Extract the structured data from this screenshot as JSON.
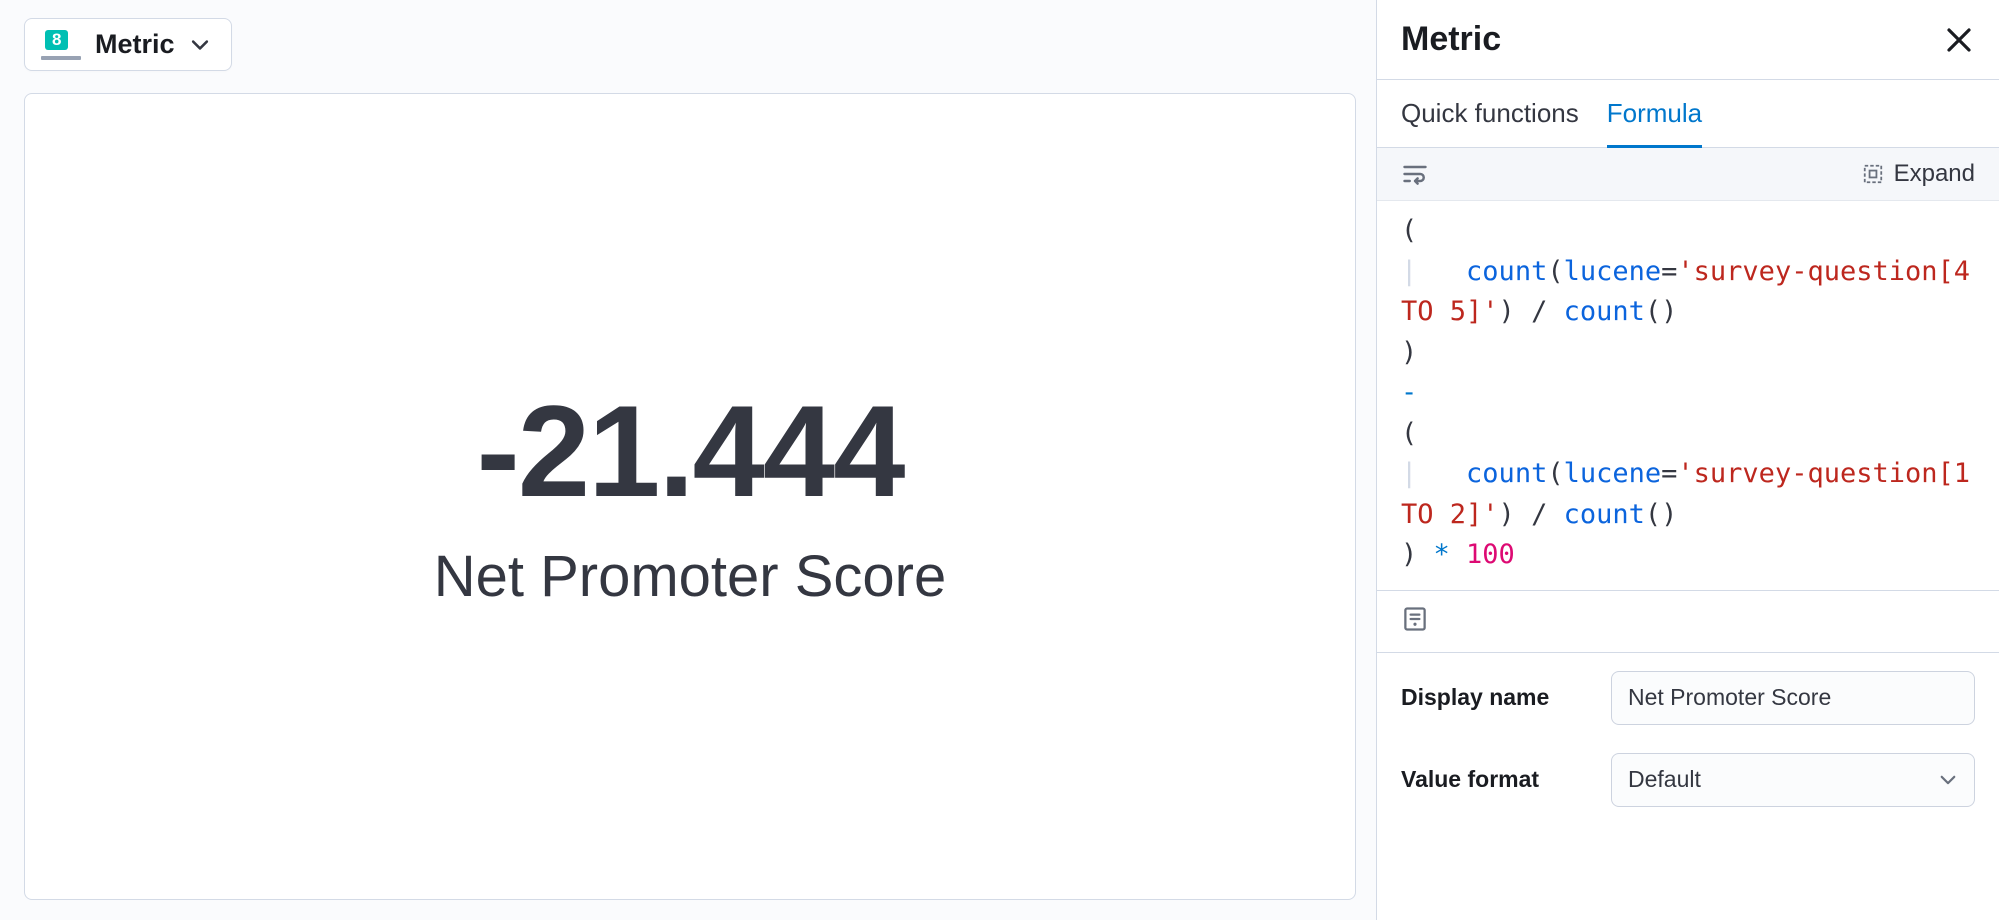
{
  "toolbar": {
    "vis_type_label": "Metric",
    "vis_type_badge": "8"
  },
  "visualization": {
    "value": "-21.444",
    "label": "Net Promoter Score"
  },
  "panel": {
    "title": "Metric",
    "tabs": {
      "quick_functions": "Quick functions",
      "formula": "Formula"
    },
    "editor_toolbar": {
      "expand_label": "Expand"
    },
    "formula": {
      "line1_open": "(",
      "line2_fn": "count",
      "line2_open": "(",
      "line2_key": "lucene",
      "line2_eq": "=",
      "line2_str": "'survey-question[4 TO 5]'",
      "line2_close": ")",
      "line2_div": " / ",
      "line2_fn2": "count",
      "line2_paren2": "()",
      "line3_close": ")",
      "line4_minus": "-",
      "line5_open": "(",
      "line6_fn": "count",
      "line6_open": "(",
      "line6_key": "lucene",
      "line6_eq": "=",
      "line6_str": "'survey-question[1 TO 2]'",
      "line6_close": ")",
      "line6_div": " / ",
      "line6_fn2": "count",
      "line6_paren2": "()",
      "line7_close": ")",
      "line7_mul": " * ",
      "line7_num": "100"
    },
    "form": {
      "display_name_label": "Display name",
      "display_name_value": "Net Promoter Score",
      "value_format_label": "Value format",
      "value_format_value": "Default"
    }
  }
}
